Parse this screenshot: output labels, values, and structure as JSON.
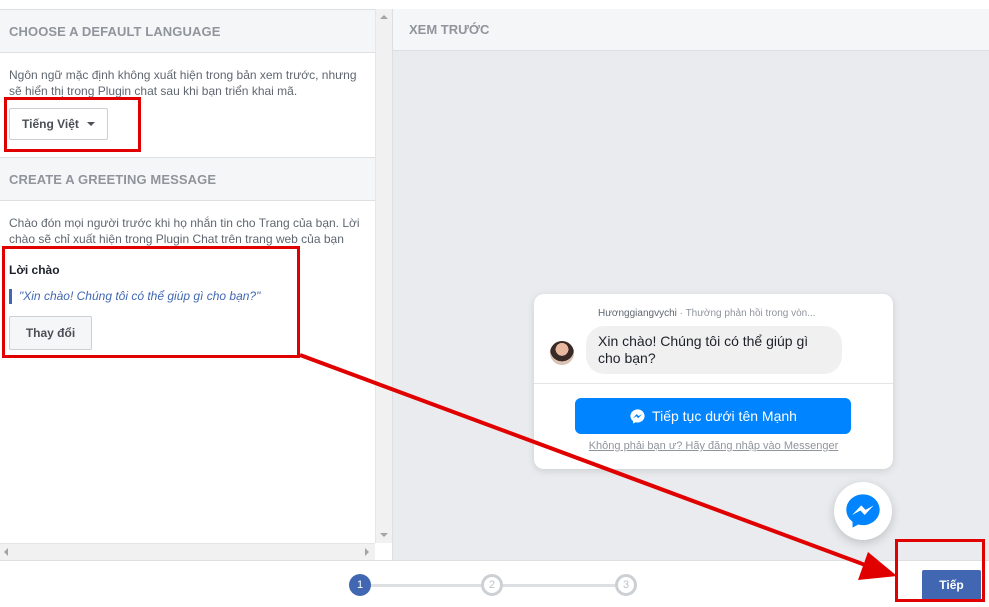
{
  "left": {
    "lang_section": {
      "title": "CHOOSE A DEFAULT LANGUAGE",
      "description": "Ngôn ngữ mặc định không xuất hiện trong bản xem trước, nhưng sẽ hiển thị trong Plugin chat sau khi bạn triển khai mã.",
      "selected_language": "Tiếng Việt"
    },
    "greeting_section": {
      "title": "CREATE A GREETING MESSAGE",
      "description": "Chào đón mọi người trước khi họ nhắn tin cho Trang của bạn. Lời chào sẽ chỉ xuất hiện trong Plugin Chat trên trang web của bạn",
      "label": "Lời chào",
      "greeting_text": "\"Xin chào! Chúng tôi có thể giúp gì cho bạn?\"",
      "change_button": "Thay đổi"
    }
  },
  "preview": {
    "title": "XEM TRƯỚC",
    "page_name": "Hươnggiangvychi",
    "response_time": "· Thường phản hồi trong vòn...",
    "bubble_text": "Xin chào! Chúng tôi có thể giúp gì cho bạn?",
    "continue_button": "Tiếp tục dưới tên Mạnh",
    "not_you_link": "Không phải bạn ư? Hãy đăng nhập vào Messenger",
    "icons": {
      "continue": "messenger-icon",
      "fab": "messenger-icon"
    }
  },
  "footer": {
    "steps": [
      "1",
      "2",
      "3"
    ],
    "current_step": 1,
    "next_button": "Tiếp"
  },
  "colors": {
    "fb_blue": "#4267b2",
    "messenger_blue": "#0084ff",
    "annotation_red": "#e00000"
  }
}
